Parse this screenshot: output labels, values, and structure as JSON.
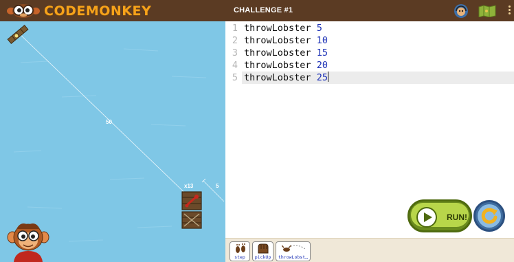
{
  "header": {
    "logo_text": "CODEMONKEY",
    "challenge_title": "CHALLENGE #1",
    "icons": [
      "monkey-mascot-icon",
      "help-headset-icon",
      "map-icon",
      "menu-dots-icon"
    ],
    "bar_color": "#5b3b23",
    "logo_color": "#f6a21a"
  },
  "game": {
    "water_color": "#7fc7e6",
    "distance_main": "50",
    "distance_short": "5",
    "multiplier": "x13",
    "icons": [
      "bridge-target-icon",
      "lobster-crate-icon",
      "empty-crate-icon",
      "monkey-character-icon"
    ]
  },
  "editor": {
    "lines": [
      {
        "num": "1",
        "command": "throwLobster",
        "arg": "5"
      },
      {
        "num": "2",
        "command": "throwLobster",
        "arg": "10"
      },
      {
        "num": "3",
        "command": "throwLobster",
        "arg": "15"
      },
      {
        "num": "4",
        "command": "throwLobster",
        "arg": "20"
      },
      {
        "num": "5",
        "command": "throwLobster",
        "arg": "25"
      }
    ],
    "active_line": 5,
    "number_color": "#1a2fb5"
  },
  "controls": {
    "run_label": "RUN!",
    "run_color": "#b8d64a",
    "reset_color": "#8bbbe3"
  },
  "toolbar": {
    "tools": [
      {
        "label": "step",
        "icon": "feet-icon"
      },
      {
        "label": "pickUp",
        "icon": "hand-grab-icon"
      },
      {
        "label": "throwLobst…",
        "icon": "throw-lobster-icon"
      }
    ]
  }
}
